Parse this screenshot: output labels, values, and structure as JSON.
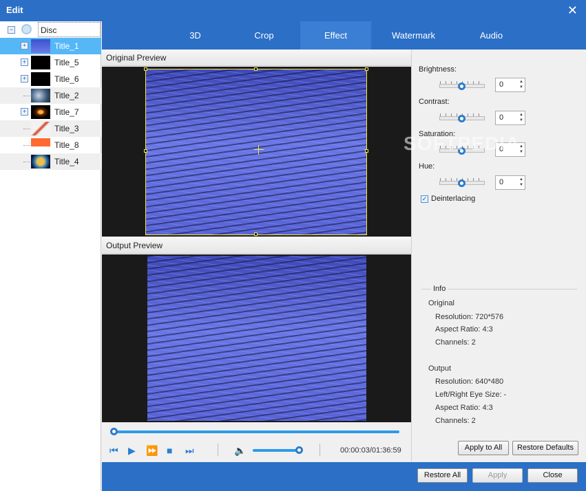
{
  "window": {
    "title": "Edit"
  },
  "tree": {
    "root": "Disc",
    "items": [
      {
        "label": "Title_1",
        "icon": "thumb-title1"
      },
      {
        "label": "Title_5",
        "icon": "thumb-title5"
      },
      {
        "label": "Title_6",
        "icon": "thumb-title6"
      },
      {
        "label": "Title_2",
        "icon": "thumb-title2"
      },
      {
        "label": "Title_7",
        "icon": "thumb-title7"
      },
      {
        "label": "Title_3",
        "icon": "thumb-title3"
      },
      {
        "label": "Title_8",
        "icon": "thumb-title8"
      },
      {
        "label": "Title_4",
        "icon": "thumb-title4"
      }
    ]
  },
  "tabs": [
    "3D",
    "Crop",
    "Effect",
    "Watermark",
    "Audio"
  ],
  "active_tab": "Effect",
  "preview": {
    "original_label": "Original Preview",
    "output_label": "Output Preview"
  },
  "player": {
    "timecode": "00:00:03/01:36:59",
    "progress_fraction": 0.0,
    "volume_fraction": 1.0
  },
  "effect": {
    "brightness_label": "Brightness:",
    "brightness_value": "0",
    "contrast_label": "Contrast:",
    "contrast_value": "0",
    "saturation_label": "Saturation:",
    "saturation_value": "0",
    "hue_label": "Hue:",
    "hue_value": "0",
    "deinterlacing_label": "Deinterlacing",
    "deinterlacing_checked": true
  },
  "info": {
    "title": "Info",
    "original_heading": "Original",
    "original_resolution": "Resolution: 720*576",
    "original_aspect": "Aspect Ratio: 4:3",
    "original_channels": "Channels: 2",
    "output_heading": "Output",
    "output_resolution": "Resolution: 640*480",
    "output_eye_size": "Left/Right Eye Size: -",
    "output_aspect": "Aspect Ratio: 4:3",
    "output_channels": "Channels: 2"
  },
  "buttons": {
    "apply_to_all": "Apply to All",
    "restore_defaults": "Restore Defaults",
    "restore_all": "Restore All",
    "apply": "Apply",
    "close": "Close"
  },
  "colors": {
    "accent": "#2b6fc7",
    "selected_row": "#56b7f7",
    "slider": "#2d9ae8"
  },
  "watermark_text": "SOFTPEDIA"
}
